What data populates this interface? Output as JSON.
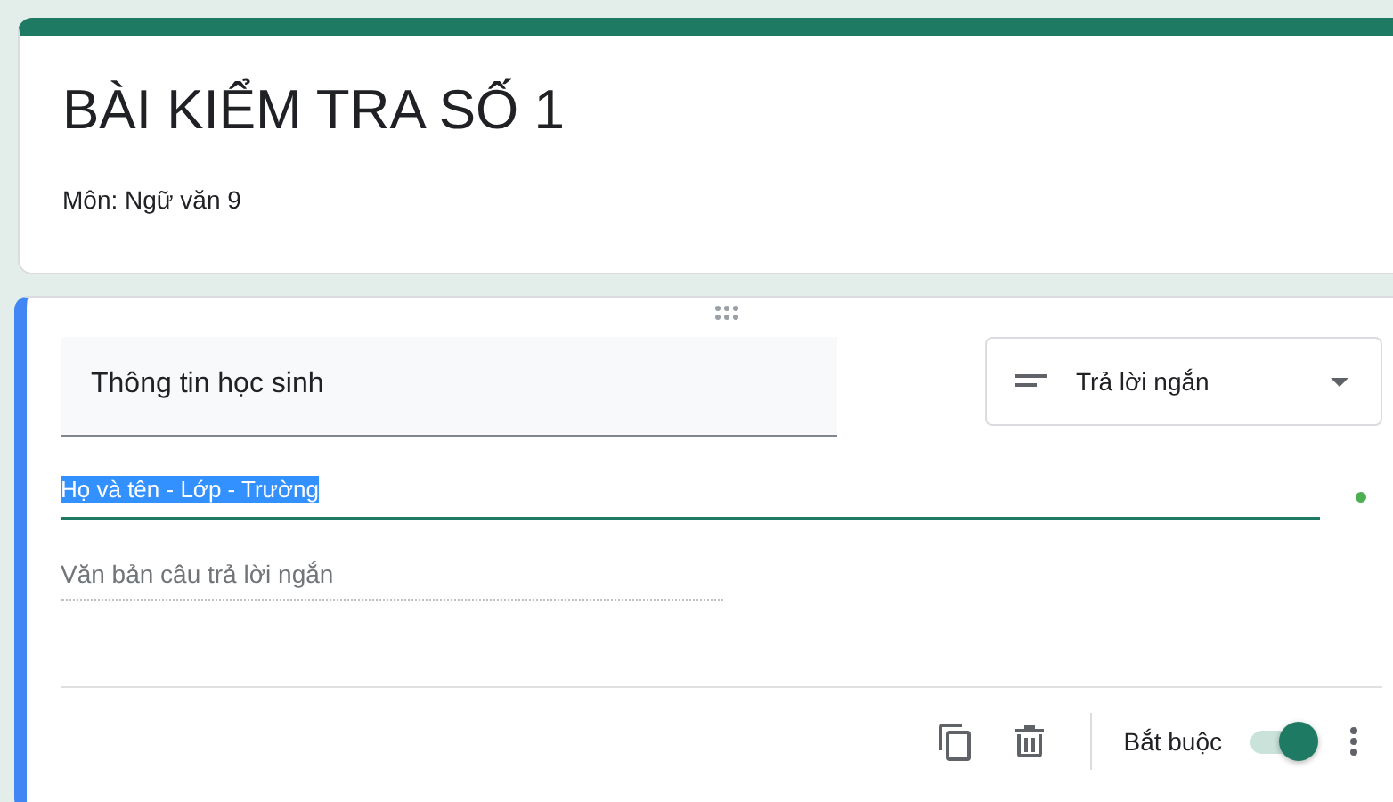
{
  "form": {
    "title": "BÀI KIỂM TRA SỐ 1",
    "description": "Môn: Ngữ văn 9"
  },
  "question": {
    "title": "Thông tin học sinh",
    "type_label": "Trả lời ngắn",
    "description": "Họ và tên - Lớp - Trường",
    "description_selected": true,
    "answer_placeholder": "Văn bản câu trả lời ngắn",
    "required_label": "Bắt buộc",
    "required": true
  }
}
